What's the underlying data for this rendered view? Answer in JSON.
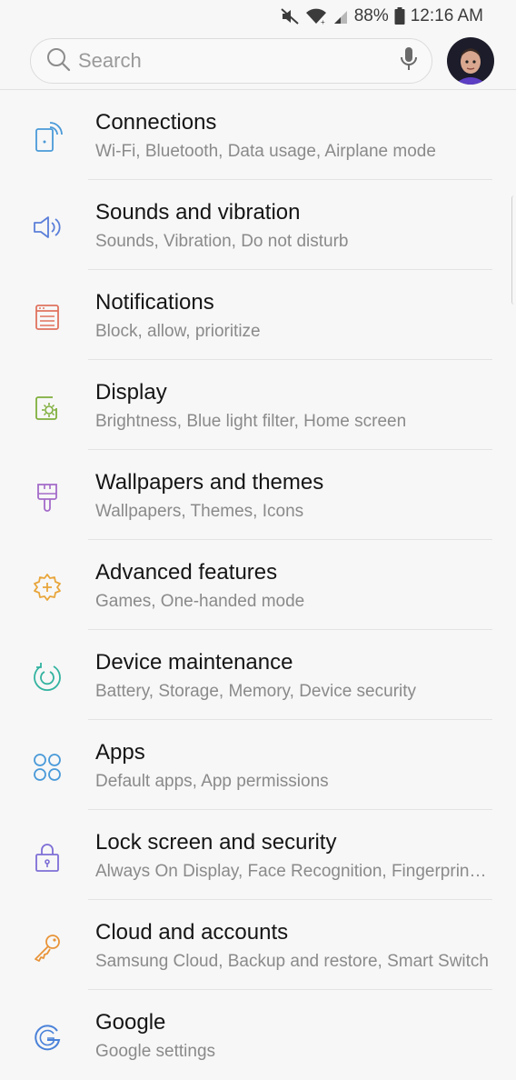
{
  "status_bar": {
    "battery": "88%",
    "time": "12:16 AM",
    "icons": [
      "mute-icon",
      "wifi-icon",
      "signal-icon",
      "battery-icon"
    ]
  },
  "search": {
    "placeholder": "Search",
    "icons": [
      "search-icon",
      "mic-icon"
    ]
  },
  "settings": [
    {
      "title": "Connections",
      "subtitle": "Wi-Fi, Bluetooth, Data usage, Airplane mode",
      "icon": "connections-icon",
      "color": "#4a9ad9"
    },
    {
      "title": "Sounds and vibration",
      "subtitle": "Sounds, Vibration, Do not disturb",
      "icon": "speaker-icon",
      "color": "#5b7fd9"
    },
    {
      "title": "Notifications",
      "subtitle": "Block, allow, prioritize",
      "icon": "notifications-icon",
      "color": "#e0735f"
    },
    {
      "title": "Display",
      "subtitle": "Brightness, Blue light filter, Home screen",
      "icon": "display-icon",
      "color": "#7fae3c"
    },
    {
      "title": "Wallpapers and themes",
      "subtitle": "Wallpapers, Themes, Icons",
      "icon": "paintbrush-icon",
      "color": "#a46bc9"
    },
    {
      "title": "Advanced features",
      "subtitle": "Games, One-handed mode",
      "icon": "gear-plus-icon",
      "color": "#e8a53a"
    },
    {
      "title": "Device maintenance",
      "subtitle": "Battery, Storage, Memory, Device security",
      "icon": "maintenance-icon",
      "color": "#33b3a0"
    },
    {
      "title": "Apps",
      "subtitle": "Default apps, App permissions",
      "icon": "apps-icon",
      "color": "#4a9ad9"
    },
    {
      "title": "Lock screen and security",
      "subtitle": "Always On Display, Face Recognition, Fingerprint scanner",
      "icon": "lock-icon",
      "color": "#7d6fd6"
    },
    {
      "title": "Cloud and accounts",
      "subtitle": "Samsung Cloud, Backup and restore, Smart Switch",
      "icon": "key-icon",
      "color": "#e8943a"
    },
    {
      "title": "Google",
      "subtitle": "Google settings",
      "icon": "google-icon",
      "color": "#4a82d9"
    }
  ]
}
